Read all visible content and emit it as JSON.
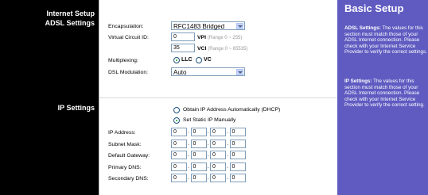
{
  "sidebar": {
    "items": [
      {
        "label": "Internet Setup"
      },
      {
        "label": "ADSL Settings"
      },
      {
        "label": "IP Settings"
      }
    ]
  },
  "adsl": {
    "encapsulation_label": "Encapsulation:",
    "encapsulation_value": "RFC1483 Bridged",
    "vc_label": "Virtual Circuit ID:",
    "vpi_value": "0",
    "vpi_label": "VPI",
    "vpi_range": "(Range 0 ~ 255)",
    "vci_value": "35",
    "vci_label": "VCI",
    "vci_range": "(Range 0 ~ 65535)",
    "multiplexing_label": "Multiplexing:",
    "llc_label": "LLC",
    "vc_option_label": "VC",
    "dsl_modulation_label": "DSL Modulation:",
    "dsl_modulation_value": "Auto"
  },
  "ip": {
    "auto_label": "Obtain IP Address Automatically (DHCP)",
    "static_label": "Set Static IP Manually",
    "fields": [
      {
        "label": "IP Address:",
        "octets": [
          "0",
          "0",
          "0",
          "0"
        ]
      },
      {
        "label": "Subnet Mask:",
        "octets": [
          "0",
          "0",
          "0",
          "0"
        ]
      },
      {
        "label": "Default Gateway:",
        "octets": [
          "0",
          "0",
          "0",
          "0"
        ]
      },
      {
        "label": "Primary DNS:",
        "octets": [
          "0",
          "0",
          "0",
          "0"
        ]
      },
      {
        "label": "Secondary DNS:",
        "octets": [
          "0",
          "0",
          "0",
          "0"
        ]
      }
    ]
  },
  "help": {
    "title": "Basic Setup",
    "adsl_heading": "ADSL Settings:",
    "adsl_text": "The values for this section must match those of your ADSL Internet connection. Please check with your Internet Service Provider to verify the correct settings.",
    "ip_heading": "IP Settings:",
    "ip_text": "The values for this section must match those of your ADSL Internet connection. Please check with your Internet Service Provider to verify the correct setting."
  }
}
